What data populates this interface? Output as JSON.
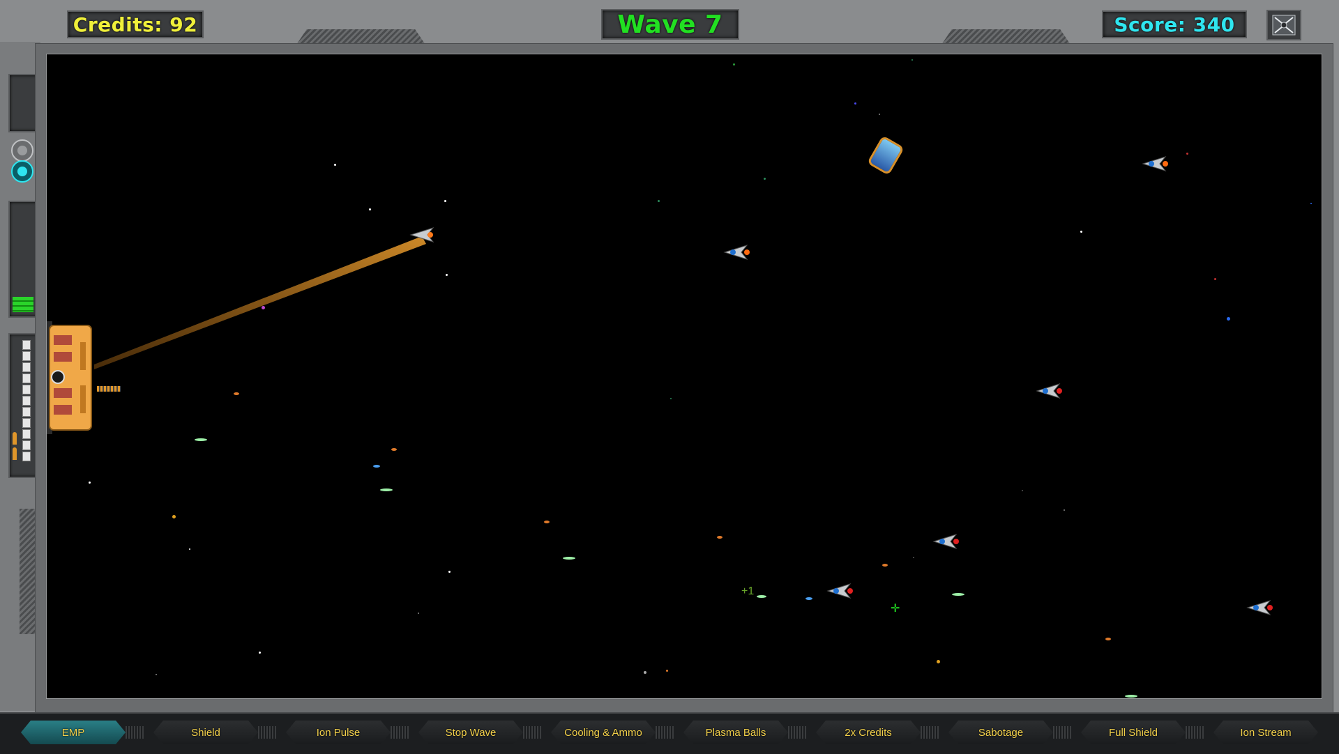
{
  "hud": {
    "credits_text": "Credits: 92",
    "wave_text": "Wave 7",
    "score_text": "Score: 340",
    "pickup_text": "+1"
  },
  "colors": {
    "credits": "#f0f03a",
    "wave": "#22e022",
    "score": "#2fe6f0",
    "active_tool": "#2a7f86",
    "beam": "#b8782a",
    "station": "#f0a848"
  },
  "toolbar": {
    "items": [
      {
        "label": "EMP"
      },
      {
        "label": "Shield"
      },
      {
        "label": "Ion Pulse"
      },
      {
        "label": "Stop Wave"
      },
      {
        "label": "Cooling & Ammo"
      },
      {
        "label": "Plasma Balls"
      },
      {
        "label": "2x Credits"
      },
      {
        "label": "Sabotage"
      },
      {
        "label": "Full Shield"
      },
      {
        "label": "Ion Stream"
      }
    ],
    "active": "EMP"
  },
  "icons": {
    "settings": "gear-icon",
    "mode_off": "circle-gray-icon",
    "mode_on": "circle-teal-icon",
    "energy": "energy-bars-icon",
    "ammo": "ammo-shell-icon"
  }
}
